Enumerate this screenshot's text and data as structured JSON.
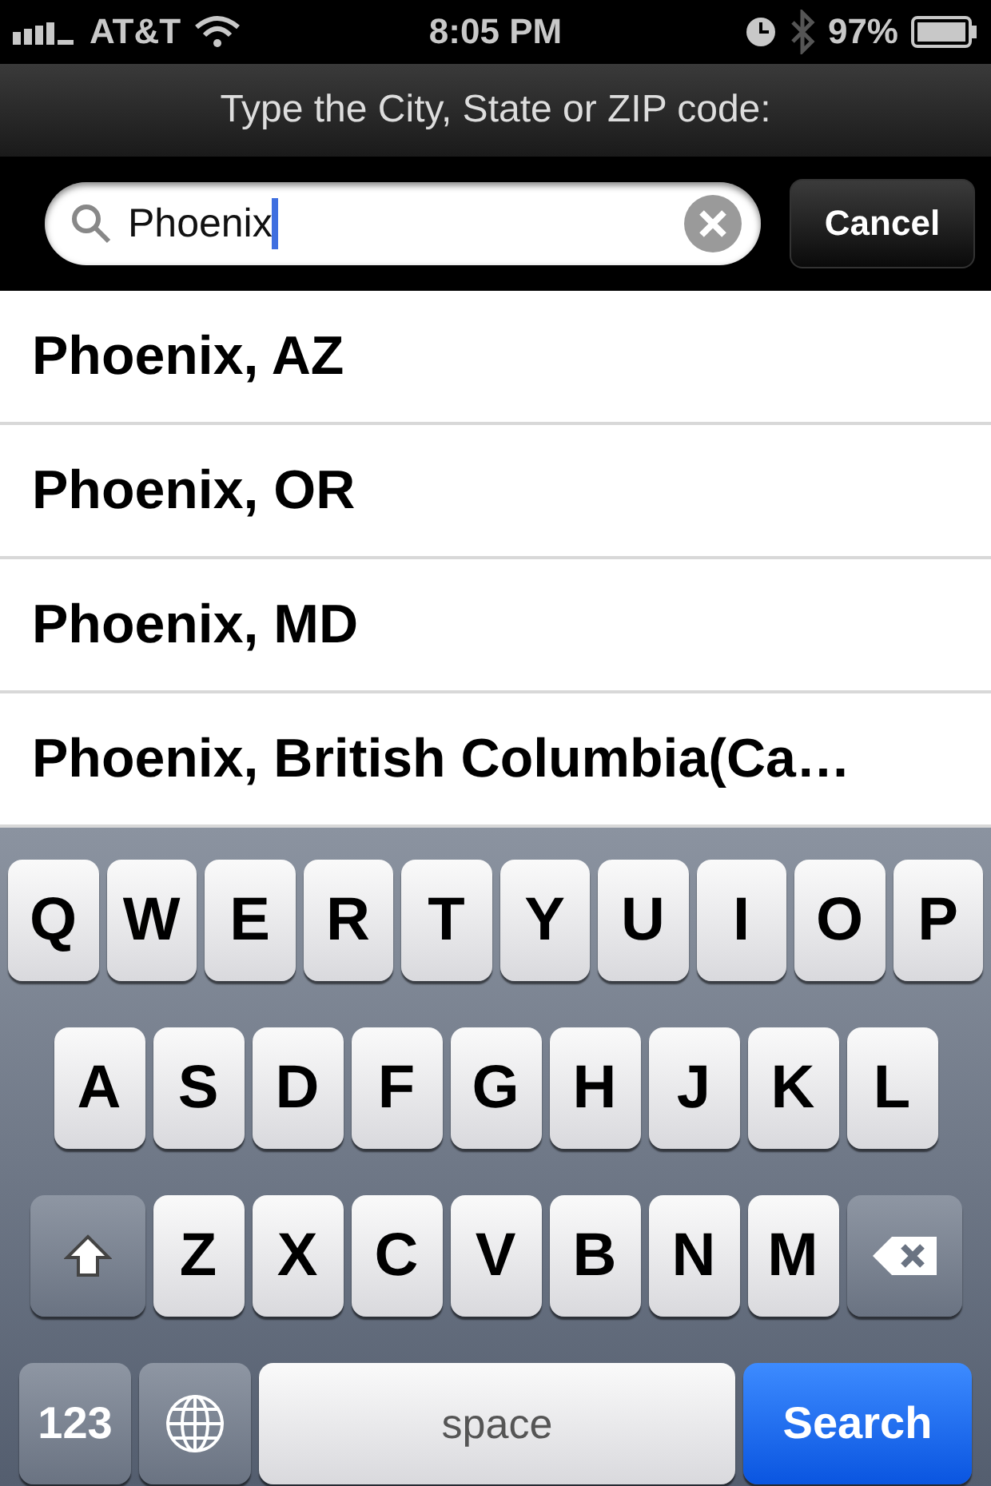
{
  "status_bar": {
    "carrier": "AT&T",
    "time": "8:05 PM",
    "battery": "97%"
  },
  "prompt": "Type the City, State or ZIP code:",
  "search": {
    "value": "Phoenix",
    "cancel": "Cancel"
  },
  "results": [
    {
      "label": "Phoenix, AZ"
    },
    {
      "label": "Phoenix, OR"
    },
    {
      "label": "Phoenix, MD"
    },
    {
      "label": "Phoenix, British Columbia(Ca…"
    }
  ],
  "keyboard": {
    "rows": [
      {
        "keys": [
          {
            "kind": "letter",
            "label": "Q"
          },
          {
            "kind": "letter",
            "label": "W"
          },
          {
            "kind": "letter",
            "label": "E"
          },
          {
            "kind": "letter",
            "label": "R"
          },
          {
            "kind": "letter",
            "label": "T"
          },
          {
            "kind": "letter",
            "label": "Y"
          },
          {
            "kind": "letter",
            "label": "U"
          },
          {
            "kind": "letter",
            "label": "I"
          },
          {
            "kind": "letter",
            "label": "O"
          },
          {
            "kind": "letter",
            "label": "P"
          }
        ]
      },
      {
        "keys": [
          {
            "kind": "letter",
            "label": "A"
          },
          {
            "kind": "letter",
            "label": "S"
          },
          {
            "kind": "letter",
            "label": "D"
          },
          {
            "kind": "letter",
            "label": "F"
          },
          {
            "kind": "letter",
            "label": "G"
          },
          {
            "kind": "letter",
            "label": "H"
          },
          {
            "kind": "letter",
            "label": "J"
          },
          {
            "kind": "letter",
            "label": "K"
          },
          {
            "kind": "letter",
            "label": "L"
          }
        ]
      },
      {
        "keys": [
          {
            "kind": "shift"
          },
          {
            "kind": "letter",
            "label": "Z"
          },
          {
            "kind": "letter",
            "label": "X"
          },
          {
            "kind": "letter",
            "label": "C"
          },
          {
            "kind": "letter",
            "label": "V"
          },
          {
            "kind": "letter",
            "label": "B"
          },
          {
            "kind": "letter",
            "label": "N"
          },
          {
            "kind": "letter",
            "label": "M"
          },
          {
            "kind": "delete"
          }
        ]
      },
      {
        "keys": [
          {
            "kind": "numbers",
            "label": "123"
          },
          {
            "kind": "globe"
          },
          {
            "kind": "space",
            "label": "space"
          },
          {
            "kind": "search",
            "label": "Search"
          }
        ]
      }
    ]
  }
}
